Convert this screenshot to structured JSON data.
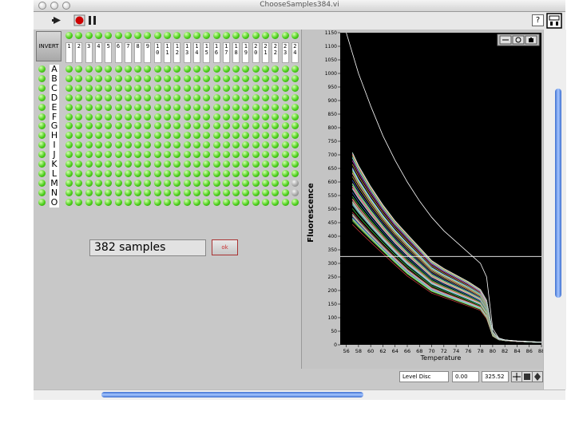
{
  "window": {
    "title": "ChooseSamples384.vi",
    "buttons": [
      "close",
      "minimize",
      "zoom",
      "toolbar"
    ]
  },
  "toolbar": {
    "run_icon": "run-arrow-icon",
    "stop_icon": "abort-stop-icon",
    "pause_icon": "pause-icon",
    "help_label": "?",
    "connector_icon": "vi-connector-icon"
  },
  "plate": {
    "invert_label": "INVERT",
    "columns": [
      "1",
      "2",
      "3",
      "4",
      "5",
      "6",
      "7",
      "8",
      "9",
      "10",
      "11",
      "12",
      "13",
      "14",
      "15",
      "16",
      "17",
      "18",
      "19",
      "20",
      "21",
      "22",
      "23",
      "24"
    ],
    "rows": [
      "A",
      "B",
      "C",
      "D",
      "E",
      "F",
      "G",
      "H",
      "I",
      "J",
      "K",
      "L",
      "M",
      "N",
      "O"
    ],
    "off_wells": [
      [
        "M",
        24
      ],
      [
        "N",
        24
      ]
    ]
  },
  "summary": {
    "samples_text": "382 samples",
    "ok_label": "ok"
  },
  "chart_data": {
    "type": "line",
    "ylabel": "Fluorescence",
    "xlabel": "Temperature",
    "xlim": [
      55,
      88
    ],
    "ylim": [
      0,
      1150
    ],
    "x_ticks": [
      "56",
      "58",
      "60",
      "62",
      "64",
      "66",
      "68",
      "70",
      "72",
      "74",
      "76",
      "78",
      "80",
      "82",
      "84",
      "86",
      "88"
    ],
    "y_ticks": [
      "0",
      "50",
      "100",
      "150",
      "200",
      "250",
      "300",
      "350",
      "400",
      "450",
      "500",
      "550",
      "600",
      "650",
      "700",
      "750",
      "800",
      "850",
      "900",
      "950",
      "1000",
      "1050",
      "1100",
      "1150"
    ],
    "level_line": 325.52,
    "background": "#000000",
    "outlier_curve": {
      "x": [
        56,
        58,
        60,
        62,
        64,
        66,
        68,
        70,
        72,
        74,
        76,
        78,
        79,
        80,
        81,
        82,
        84,
        86,
        88
      ],
      "y": [
        1150,
        1000,
        880,
        770,
        680,
        600,
        530,
        470,
        420,
        380,
        340,
        300,
        250,
        60,
        25,
        18,
        14,
        12,
        10
      ]
    },
    "band": {
      "x": [
        57,
        58,
        60,
        62,
        64,
        66,
        68,
        70,
        72,
        74,
        76,
        78,
        79,
        80,
        81,
        82,
        84,
        86,
        88
      ],
      "y_top": [
        730,
        680,
        600,
        530,
        470,
        420,
        370,
        320,
        290,
        265,
        240,
        210,
        170,
        50,
        22,
        18,
        14,
        12,
        10
      ],
      "y_bot": [
        420,
        400,
        360,
        320,
        280,
        240,
        210,
        180,
        165,
        150,
        135,
        120,
        90,
        30,
        18,
        15,
        12,
        10,
        8
      ]
    },
    "series_count": 382
  },
  "graph_tools": {
    "icons": [
      "cursor-move-icon",
      "zoom-icon",
      "pan-hand-icon"
    ]
  },
  "cursor_panel": {
    "name": "Level Disc",
    "x_value": "0.00",
    "y_value": "325.52"
  }
}
